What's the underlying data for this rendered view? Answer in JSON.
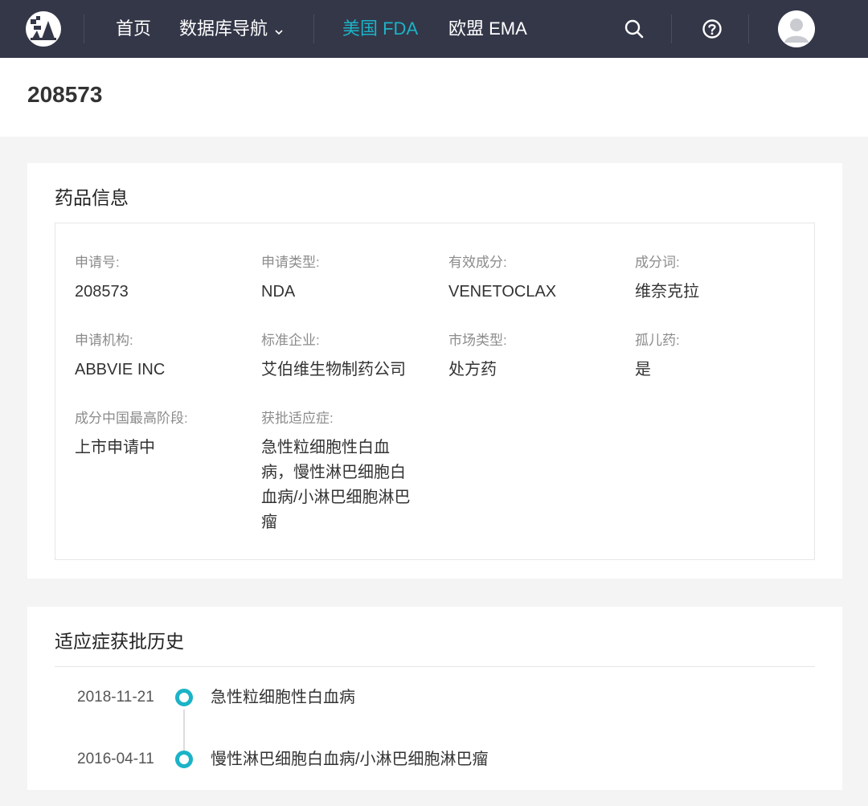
{
  "nav": {
    "items": [
      {
        "label": "首页",
        "active": false
      },
      {
        "label": "数据库导航",
        "active": false,
        "dropdown": true
      },
      {
        "label": "美国 FDA",
        "active": true
      },
      {
        "label": "欧盟 EMA",
        "active": false
      }
    ],
    "icons": [
      "search-icon",
      "help-icon",
      "avatar"
    ],
    "accent_color": "#1bb3c7",
    "bg_color": "#343748"
  },
  "page": {
    "title": "208573"
  },
  "drug_info": {
    "title": "药品信息",
    "fields": [
      {
        "label": "申请号:",
        "value": "208573"
      },
      {
        "label": "申请类型:",
        "value": "NDA"
      },
      {
        "label": "有效成分:",
        "value": "VENETOCLAX"
      },
      {
        "label": "成分词:",
        "value": "维奈克拉"
      },
      {
        "label": "申请机构:",
        "value": "ABBVIE INC"
      },
      {
        "label": "标准企业:",
        "value": "艾伯维生物制药公司"
      },
      {
        "label": "市场类型:",
        "value": "处方药"
      },
      {
        "label": "孤儿药:",
        "value": "是"
      },
      {
        "label": "成分中国最高阶段:",
        "value": "上市申请中"
      },
      {
        "label": "获批适应症:",
        "value": "急性粒细胞性白血病，慢性淋巴细胞白血病/小淋巴细胞淋巴瘤"
      }
    ]
  },
  "history": {
    "title": "适应症获批历史",
    "entries": [
      {
        "date": "2018-11-21",
        "text": "急性粒细胞性白血病"
      },
      {
        "date": "2016-04-11",
        "text": "慢性淋巴细胞白血病/小淋巴细胞淋巴瘤"
      }
    ]
  }
}
